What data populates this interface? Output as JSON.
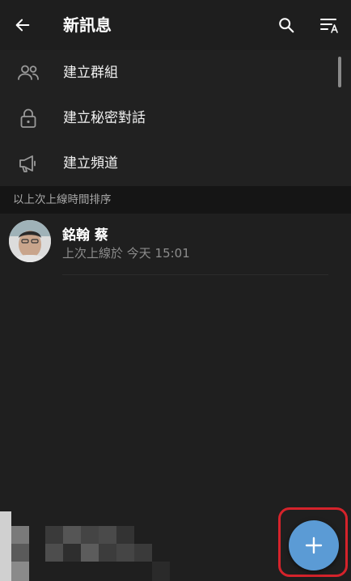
{
  "header": {
    "title": "新訊息",
    "back_icon": "arrow-left-icon",
    "search_icon": "search-icon",
    "sort_icon": "sort-by-name-icon"
  },
  "actions": [
    {
      "label": "建立群組",
      "icon": "people-icon"
    },
    {
      "label": "建立秘密對話",
      "icon": "lock-icon"
    },
    {
      "label": "建立頻道",
      "icon": "megaphone-icon"
    }
  ],
  "section": {
    "title": "以上次上線時間排序"
  },
  "contacts": [
    {
      "name": "銘翰 蔡",
      "status": "上次上線於 今天 15:01"
    }
  ],
  "fab": {
    "icon": "plus-icon",
    "color": "#5b9bd5",
    "highlight_color": "#d5232b"
  },
  "theme": {
    "background": "#1f1f1f",
    "section_background": "#151515",
    "text_primary": "#ffffff",
    "text_secondary": "#8c8c8c"
  }
}
